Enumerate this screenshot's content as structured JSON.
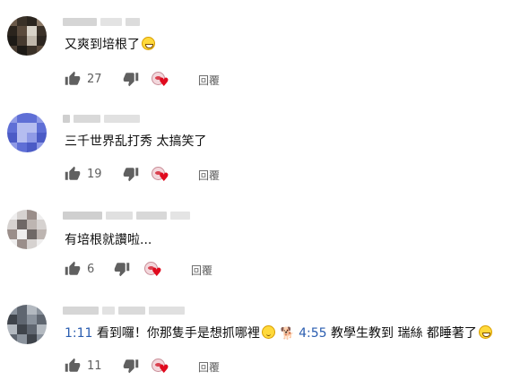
{
  "comments": [
    {
      "text_before": "又爽到培根了",
      "likes": "27",
      "reply_label": "回覆",
      "avatar_colors": [
        "#3a3128",
        "#d8d2c8",
        "#1d1a16",
        "#5a4a3c"
      ]
    },
    {
      "text_before": "三千世界乱打秀  太搞笑了",
      "likes": "19",
      "reply_label": "回覆",
      "avatar_colors": [
        "#5f6fd6",
        "#8f9ae6",
        "#4b5bc6",
        "#b5bdf0"
      ]
    },
    {
      "text_before": "有培根就讚啦...",
      "likes": "6",
      "reply_label": "回覆",
      "avatar_colors": [
        "#d6d2d0",
        "#9a8e8a",
        "#efeeee",
        "#6f6866"
      ]
    },
    {
      "ts1": "1:11",
      "seg1": " 看到囉！你那隻手是想抓哪裡",
      "ts2": "4:55",
      "seg2": " 教學生教到 瑞絲 都睡著了",
      "likes": "11",
      "reply_label": "回覆",
      "avatar_colors": [
        "#5f6670",
        "#8a929c",
        "#3f444b",
        "#b3b9c0"
      ]
    }
  ],
  "icons": {
    "like": "thumb-up-icon",
    "dislike": "thumb-down-icon",
    "creator_heart": "creator-heart-icon",
    "emoji_grin": "grinning-emoji-icon",
    "emoji_wink": "winking-emoji-icon",
    "emoji_dog": "dog-emoji-icon"
  },
  "colors": {
    "timestamp_link": "#2a5db0",
    "heart": "#e00a1e",
    "meta_text": "#606060"
  }
}
